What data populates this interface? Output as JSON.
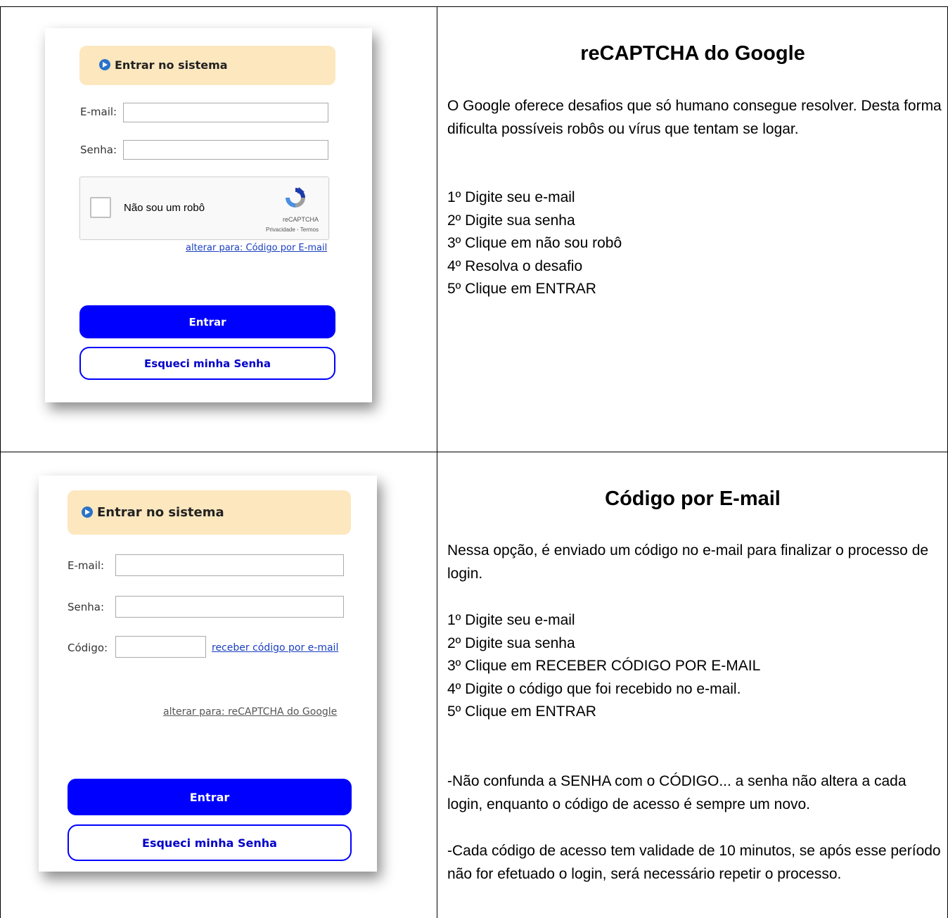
{
  "panel1": {
    "header": "Entrar no sistema",
    "email_label": "E-mail:",
    "senha_label": "Senha:",
    "captcha": {
      "label": "Não sou um robô",
      "brand": "reCAPTCHA",
      "terms": "Privacidade - Termos"
    },
    "switch_link": "alterar para: Código por E-mail",
    "entrar": "Entrar",
    "esqueci": "Esqueci minha Senha"
  },
  "right1": {
    "title": "reCAPTCHA do Google",
    "intro": "O Google oferece desafios que só humano consegue resolver. Desta forma dificulta possíveis robôs ou vírus que tentam se logar.",
    "steps": [
      "1º Digite seu e-mail",
      "2º Digite sua senha",
      "3º Clique em não sou robô",
      "4º Resolva o desafio",
      "5º Clique em ENTRAR"
    ]
  },
  "panel2": {
    "header": "Entrar no sistema",
    "email_label": "E-mail:",
    "senha_label": "Senha:",
    "codigo_label": "Código:",
    "receber_link": "receber código por e-mail",
    "switch_link": "alterar para: reCAPTCHA do Google",
    "entrar": "Entrar",
    "esqueci": "Esqueci minha Senha"
  },
  "right2": {
    "title": "Código por E-mail",
    "intro": "Nessa opção, é enviado um código no e-mail para finalizar o processo de login.",
    "steps": [
      "1º Digite seu e-mail",
      "2º Digite sua senha",
      "3º Clique em RECEBER CÓDIGO POR E-MAIL",
      "4º Digite o código que foi recebido no e-mail.",
      "5º Clique em ENTRAR"
    ],
    "note1": "-Não confunda a SENHA com o CÓDIGO... a senha não altera a cada login, enquanto o código de acesso é sempre um novo.",
    "note2": "-Cada código de acesso tem validade de 10 minutos, se após esse período não for efetuado o login, será necessário repetir o processo."
  }
}
